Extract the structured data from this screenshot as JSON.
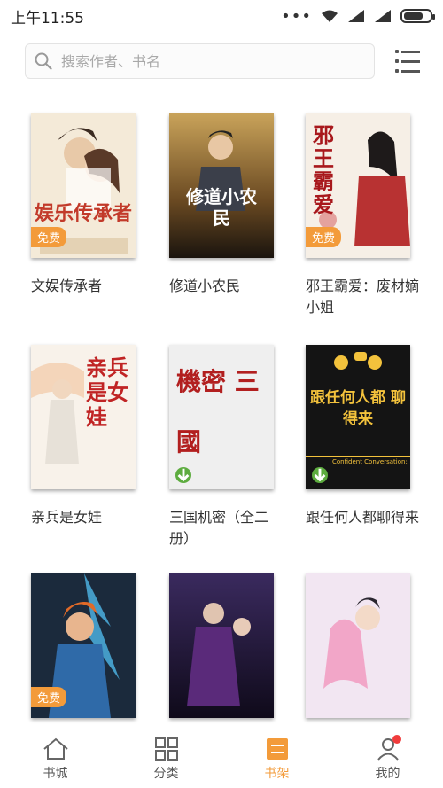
{
  "status_bar": {
    "time": "上午11:55",
    "battery_level": 0.75
  },
  "search": {
    "placeholder": "搜索作者、书名"
  },
  "books": [
    {
      "title": "文娱传承者",
      "free_badge": "免费",
      "cover_text": "娱乐传承者"
    },
    {
      "title": "修道小农民",
      "cover_text": "修道小农民"
    },
    {
      "title": "邪王霸爱：废材嫡小姐",
      "free_badge": "免费",
      "cover_text": "邪王霸爱"
    },
    {
      "title": "亲兵是女娃",
      "cover_text": "亲兵是女娃"
    },
    {
      "title": "三国机密（全二册）",
      "cover_text": "機密 三國"
    },
    {
      "title": "跟任何人都聊得来",
      "cover_text": "跟任何人都 聊得来",
      "cover_subtitle": "Confident Conversation:"
    },
    {
      "title": "",
      "free_badge": "免费"
    },
    {
      "title": ""
    },
    {
      "title": ""
    }
  ],
  "nav": {
    "tabs": [
      {
        "label": "书城",
        "icon": "home-icon"
      },
      {
        "label": "分类",
        "icon": "grid-icon"
      },
      {
        "label": "书架",
        "icon": "bookshelf-icon",
        "active": true
      },
      {
        "label": "我的",
        "icon": "user-icon",
        "badge_dot": true
      }
    ]
  },
  "colors": {
    "accent": "#f39b3a",
    "notification": "#f03c3c",
    "download": "#5dac3f"
  }
}
